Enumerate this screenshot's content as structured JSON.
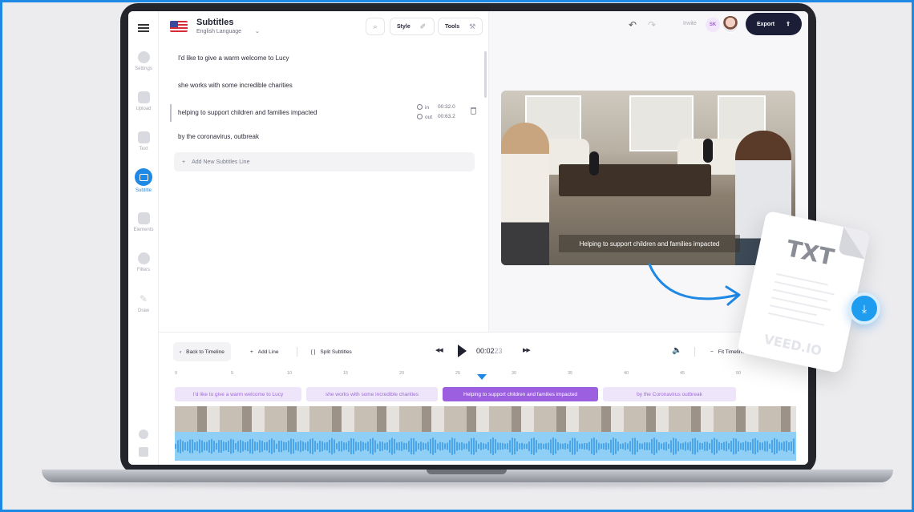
{
  "header": {
    "title": "Subtitles",
    "language": "English Language",
    "style_label": "Style",
    "tools_label": "Tools",
    "invite_label": "Invite",
    "user_initials": "SK",
    "export_label": "Export"
  },
  "sidebar": {
    "items": [
      {
        "label": "Settings"
      },
      {
        "label": "Upload"
      },
      {
        "label": "Text"
      },
      {
        "label": "Subtitle"
      },
      {
        "label": "Elements"
      },
      {
        "label": "Filters"
      },
      {
        "label": "Draw"
      }
    ],
    "active": "Subtitle"
  },
  "subtitles": {
    "lines": [
      "I'd like to give a warm welcome to Lucy",
      "she works with some incredible charities",
      "helping to support children and families impacted",
      "by the coronavirus, outbreak"
    ],
    "selected_in_label": "in",
    "selected_in": "00:32.0",
    "selected_out_label": "out",
    "selected_out": "00:63.2",
    "add_line_label": "Add New Subtitles Line"
  },
  "video": {
    "caption": "Helping to support children and families impacted"
  },
  "timeline": {
    "back_label": "Back to Timeline",
    "add_line_label": "Add Line",
    "split_label": "Split Subtitles",
    "time_main": "00:02",
    "time_frames": "23",
    "fit_label": "Fit Timeline",
    "ticks": [
      "0",
      "5",
      "10",
      "15",
      "20",
      "25",
      "30",
      "35",
      "40",
      "45",
      "50"
    ],
    "clips": [
      "I'd like to give a warm welcome to Lucy",
      "she works with some incredible charities",
      "Helping to support children and families impacted",
      "by the Coronavirus outbreak"
    ],
    "active_clip_index": 2
  },
  "file_badge": {
    "extension": "TXT",
    "brand": "VEED.IO"
  },
  "colors": {
    "accent": "#1e88e5",
    "clip_active": "#9c5fe0",
    "clip_inactive": "#efe5fb",
    "export_bg": "#1b1e36"
  }
}
